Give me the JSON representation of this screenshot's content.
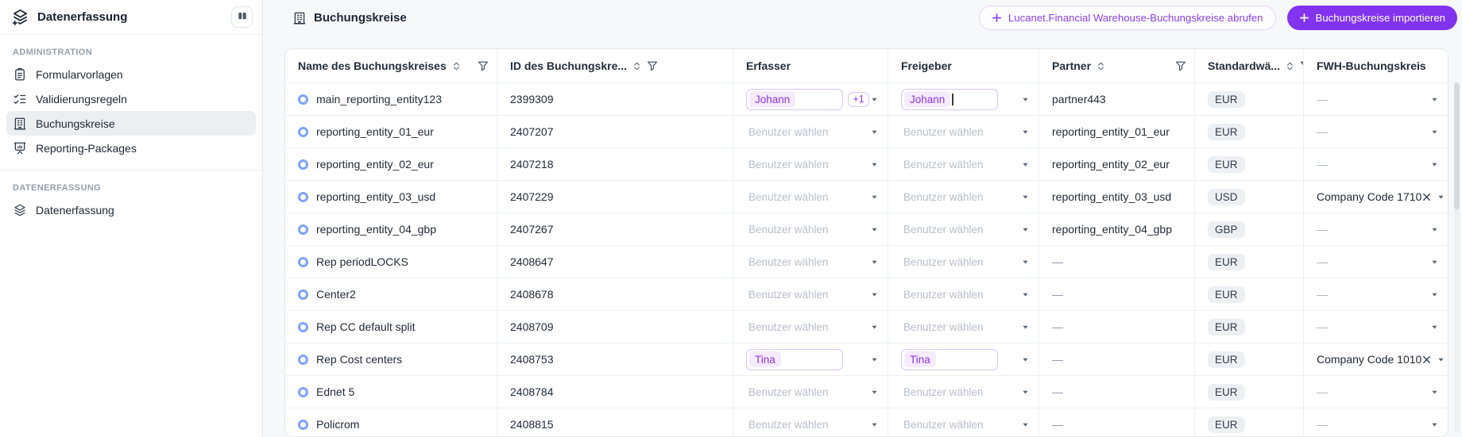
{
  "sidebar": {
    "title": "Datenerfassung",
    "sections": [
      {
        "label": "ADMINISTRATION",
        "items": [
          {
            "label": "Formularvorlagen",
            "icon": "clipboard-icon",
            "active": false
          },
          {
            "label": "Validierungsregeln",
            "icon": "checklist-icon",
            "active": false
          },
          {
            "label": "Buchungskreise",
            "icon": "building-icon",
            "active": true
          },
          {
            "label": "Reporting-Packages",
            "icon": "presentation-icon",
            "active": false
          }
        ]
      },
      {
        "label": "DATENERFASSUNG",
        "items": [
          {
            "label": "Datenerfassung",
            "icon": "layers-icon",
            "active": false
          }
        ]
      }
    ]
  },
  "header": {
    "title": "Buchungskreise",
    "title_icon": "building-icon",
    "buttons": [
      {
        "label": "Lucanet.Financial Warehouse-Buchungskreise abrufen",
        "style": "outline",
        "icon": "plus-icon"
      },
      {
        "label": "Buchungskreise importieren",
        "style": "filled",
        "icon": "plus-icon"
      }
    ]
  },
  "table": {
    "columns": [
      {
        "label": "Name des Buchungskreises",
        "sort": true,
        "filter": "right"
      },
      {
        "label": "ID des Buchungskre...",
        "sort": true,
        "filter": "inline"
      },
      {
        "label": "Erfasser",
        "sort": false,
        "filter": "none"
      },
      {
        "label": "Freigeber",
        "sort": false,
        "filter": "none"
      },
      {
        "label": "Partner",
        "sort": true,
        "filter": "right"
      },
      {
        "label": "Standardwä...",
        "sort": true,
        "filter": "inline"
      },
      {
        "label": "FWH-Buchungskreis",
        "sort": false,
        "filter": "none"
      }
    ],
    "user_placeholder": "Benutzer wählen",
    "empty_value": "—",
    "rows": [
      {
        "name": "main_reporting_entity123",
        "id": "2399309",
        "erfasser": {
          "type": "chips",
          "chip": "Johann",
          "extra": "+1"
        },
        "freigeber": {
          "type": "chips",
          "chip": "Johann",
          "cursor": true
        },
        "partner": "partner443",
        "currency": "EUR",
        "fwh": null
      },
      {
        "name": "reporting_entity_01_eur",
        "id": "2407207",
        "erfasser": {
          "type": "placeholder"
        },
        "freigeber": {
          "type": "placeholder"
        },
        "partner": "reporting_entity_01_eur",
        "currency": "EUR",
        "fwh": null
      },
      {
        "name": "reporting_entity_02_eur",
        "id": "2407218",
        "erfasser": {
          "type": "placeholder"
        },
        "freigeber": {
          "type": "placeholder"
        },
        "partner": "reporting_entity_02_eur",
        "currency": "EUR",
        "fwh": null
      },
      {
        "name": "reporting_entity_03_usd",
        "id": "2407229",
        "erfasser": {
          "type": "placeholder"
        },
        "freigeber": {
          "type": "placeholder"
        },
        "partner": "reporting_entity_03_usd",
        "currency": "USD",
        "fwh": "Company Code 1710"
      },
      {
        "name": "reporting_entity_04_gbp",
        "id": "2407267",
        "erfasser": {
          "type": "placeholder"
        },
        "freigeber": {
          "type": "placeholder"
        },
        "partner": "reporting_entity_04_gbp",
        "currency": "GBP",
        "fwh": null
      },
      {
        "name": "Rep periodLOCKS",
        "id": "2408647",
        "erfasser": {
          "type": "placeholder"
        },
        "freigeber": {
          "type": "placeholder"
        },
        "partner": null,
        "currency": "EUR",
        "fwh": null
      },
      {
        "name": "Center2",
        "id": "2408678",
        "erfasser": {
          "type": "placeholder"
        },
        "freigeber": {
          "type": "placeholder"
        },
        "partner": null,
        "currency": "EUR",
        "fwh": null
      },
      {
        "name": "Rep CC default split",
        "id": "2408709",
        "erfasser": {
          "type": "placeholder"
        },
        "freigeber": {
          "type": "placeholder"
        },
        "partner": null,
        "currency": "EUR",
        "fwh": null
      },
      {
        "name": "Rep Cost centers",
        "id": "2408753",
        "erfasser": {
          "type": "chips",
          "chip": "Tina"
        },
        "freigeber": {
          "type": "chips",
          "chip": "Tina"
        },
        "partner": null,
        "currency": "EUR",
        "fwh": "Company Code 1010"
      },
      {
        "name": "Ednet 5",
        "id": "2408784",
        "erfasser": {
          "type": "placeholder"
        },
        "freigeber": {
          "type": "placeholder"
        },
        "partner": null,
        "currency": "EUR",
        "fwh": null
      },
      {
        "name": "Policrom",
        "id": "2408815",
        "erfasser": {
          "type": "placeholder"
        },
        "freigeber": {
          "type": "placeholder"
        },
        "partner": null,
        "currency": "EUR",
        "fwh": null
      }
    ]
  },
  "colors": {
    "accent_purple": "#8233ee",
    "chip_text": "#8f35ea",
    "chip_bg": "#f5ebfe",
    "badge_bg": "#edf0f3",
    "row_icon_blue": "#7fa3f7",
    "page_bg": "#f7f8f9"
  }
}
